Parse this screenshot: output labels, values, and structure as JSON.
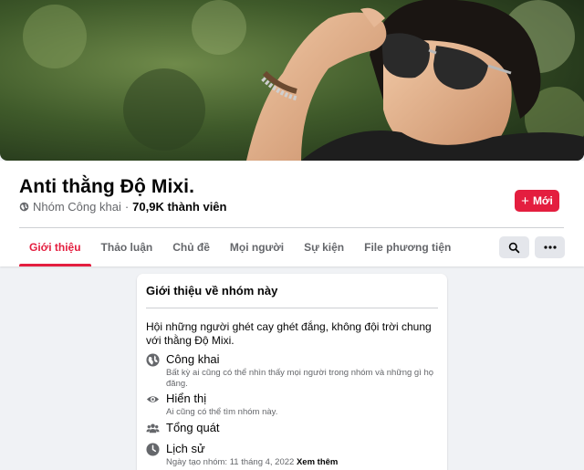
{
  "group": {
    "name": "Anti thằng Độ Mixi.",
    "privacy": "Nhóm Công khai",
    "separator": "·",
    "members": "70,9K thành viên"
  },
  "actions": {
    "new_label": "Mới",
    "new_icon": "plus-icon",
    "search_icon": "search-icon",
    "more_icon": "more-icon"
  },
  "tabs": [
    {
      "label": "Giới thiệu",
      "active": true
    },
    {
      "label": "Thảo luận",
      "active": false
    },
    {
      "label": "Chủ đề",
      "active": false
    },
    {
      "label": "Mọi người",
      "active": false
    },
    {
      "label": "Sự kiện",
      "active": false
    },
    {
      "label": "File phương tiện",
      "active": false
    }
  ],
  "about": {
    "title": "Giới thiệu về nhóm này",
    "description": "Hội những người ghét cay ghét đắng, không đội trời chung với thằng Độ Mixi.",
    "items": [
      {
        "icon": "globe-icon",
        "title": "Công khai",
        "subtitle": "Bất kỳ ai cũng có thể nhìn thấy mọi người trong nhóm và những gì họ đăng."
      },
      {
        "icon": "eye-icon",
        "title": "Hiển thị",
        "subtitle": "Ai cũng có thể tìm nhóm này."
      },
      {
        "icon": "people-icon",
        "title": "Tổng quát",
        "subtitle": ""
      },
      {
        "icon": "clock-icon",
        "title": "Lịch sử",
        "subtitle": "Ngày tạo nhóm: 11 tháng 4, 2022",
        "link": "Xem thêm"
      }
    ]
  },
  "colors": {
    "accent": "#e41e3f",
    "secondary_text": "#65676b",
    "background": "#f0f2f5"
  }
}
